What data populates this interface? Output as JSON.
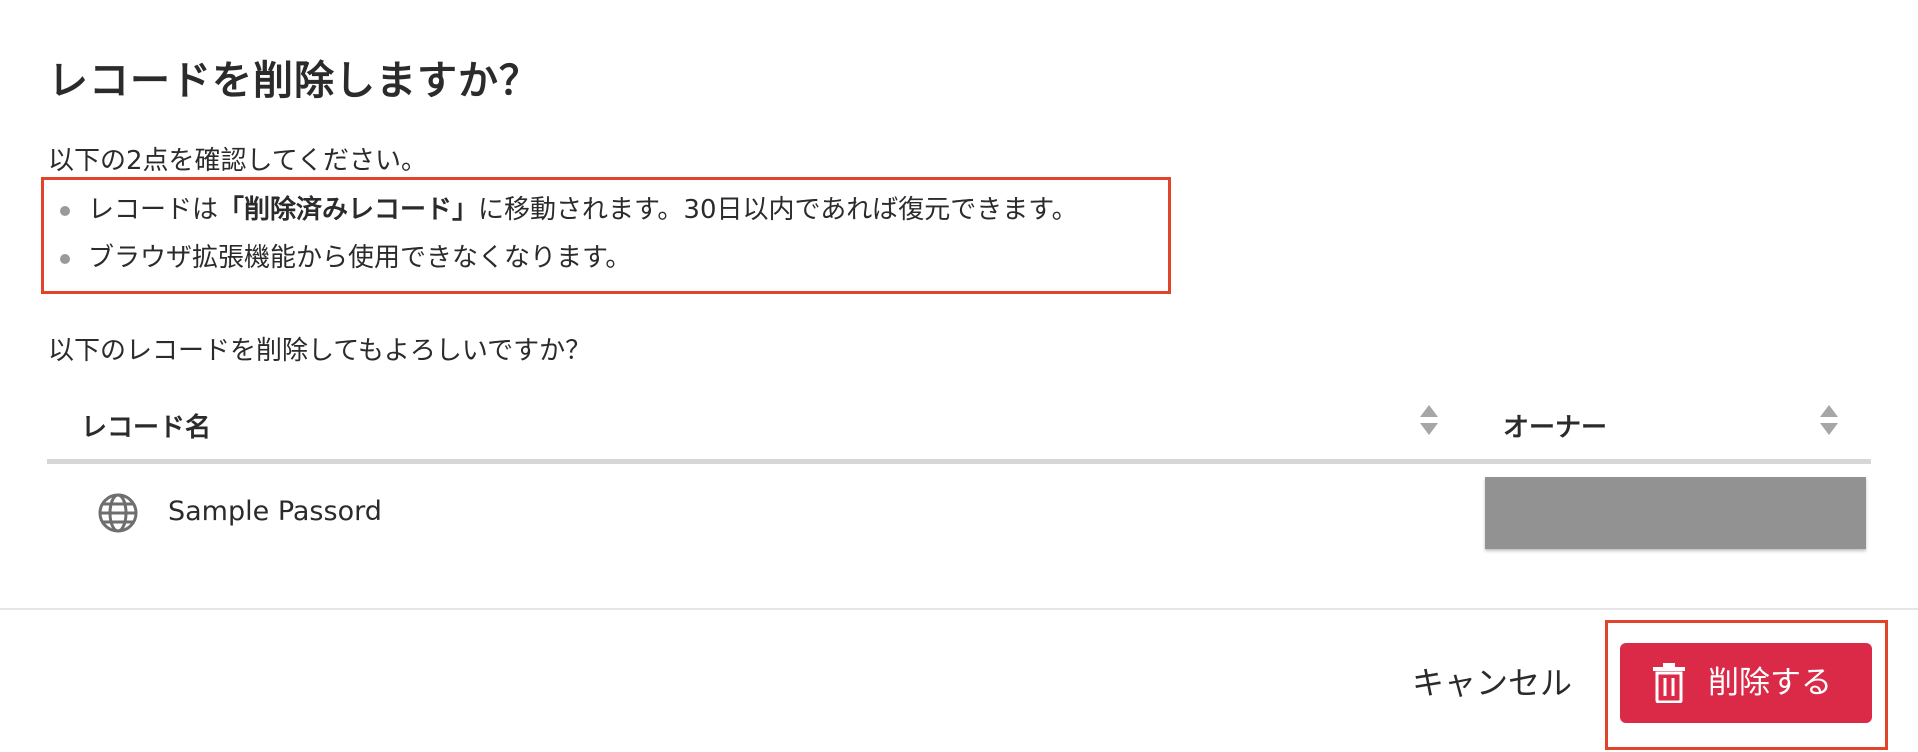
{
  "dialog": {
    "title": "レコードを削除しますか？",
    "intro": "以下の2点を確認してください。",
    "bullets": [
      {
        "prefix": "レコードは",
        "bold": "「削除済みレコード」",
        "suffix": "に移動されます。30日以内であれば復元できます。"
      },
      {
        "text": "ブラウザ拡張機能から使用できなくなります。"
      }
    ],
    "question": "以下のレコードを削除してもよろしいですか？"
  },
  "table": {
    "columns": [
      "レコード名",
      "オーナー"
    ],
    "rows": [
      {
        "icon": "globe-icon",
        "name": "Sample Passord"
      }
    ]
  },
  "footer": {
    "cancel_label": "キャンセル",
    "delete_label": "削除する"
  },
  "colors": {
    "highlight_border": "#e0452c",
    "delete_button": "#db2a48",
    "owner_redacted": "#929292"
  }
}
